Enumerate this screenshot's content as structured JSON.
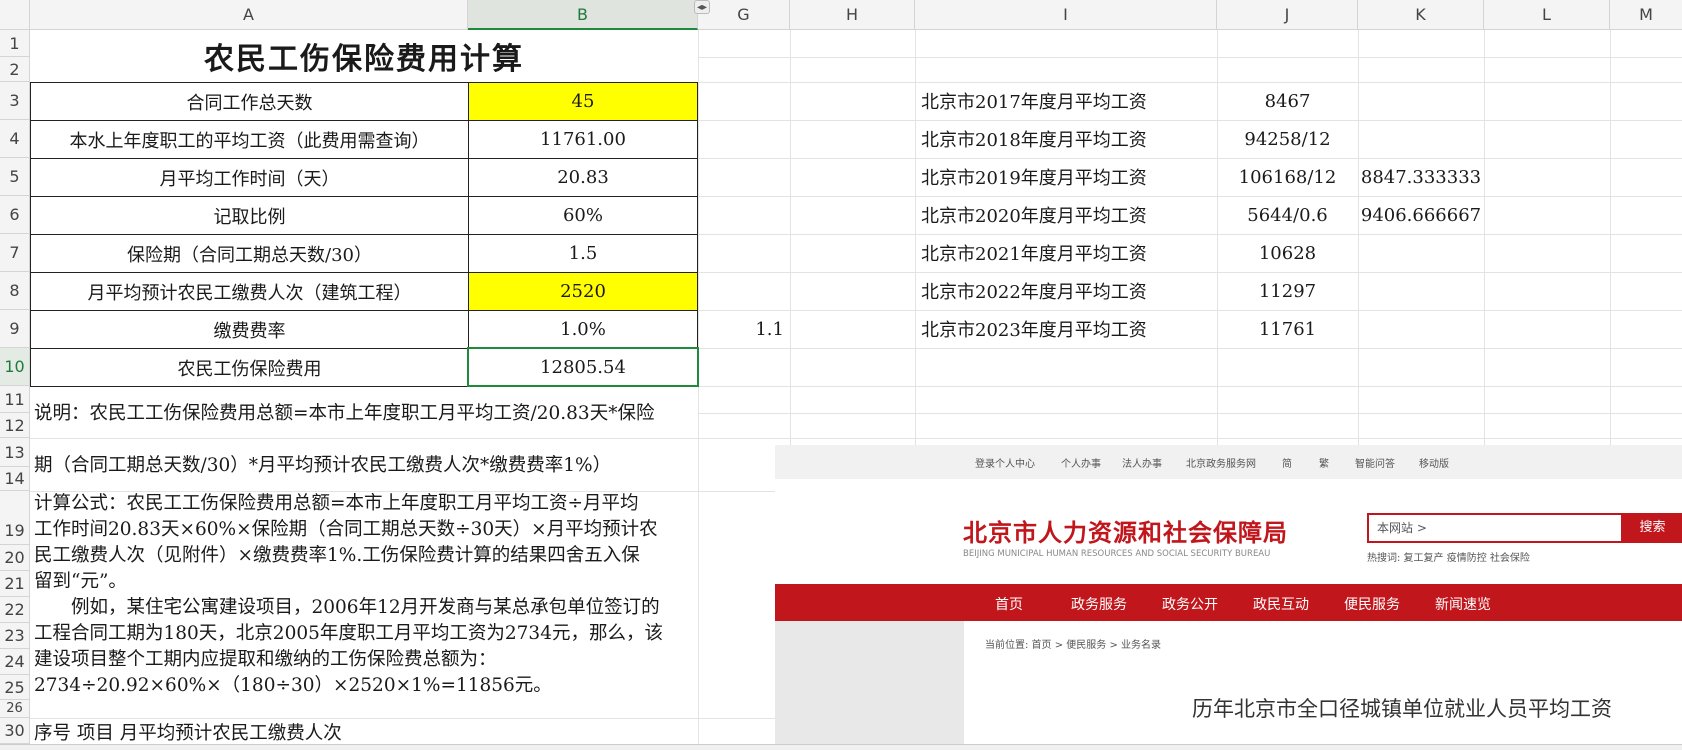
{
  "columns": [
    "A",
    "B",
    "G",
    "H",
    "I",
    "J",
    "K",
    "L",
    "M"
  ],
  "rows": [
    "1",
    "2",
    "3",
    "4",
    "5",
    "6",
    "7",
    "8",
    "9",
    "10",
    "11",
    "12",
    "13",
    "14",
    "19",
    "20",
    "21",
    "22",
    "23",
    "24",
    "25",
    "26",
    "30"
  ],
  "sheet": {
    "title": "农民工伤保险费用计算",
    "table": [
      {
        "label": "合同工作总天数",
        "value": "45",
        "highlight": "#ffff00"
      },
      {
        "label": "本水上年度职工的平均工资（此费用需查询）",
        "value": "11761.00"
      },
      {
        "label": "月平均工作时间（天）",
        "value": "20.83"
      },
      {
        "label": "记取比例",
        "value": "60%"
      },
      {
        "label": "保险期（合同工期总天数/30）",
        "value": "1.5"
      },
      {
        "label": "月平均预计农民工缴费人次（建筑工程）",
        "value": "2520",
        "highlight": "#ffff00"
      },
      {
        "label": "缴费费率",
        "value": "1.0%"
      },
      {
        "label": "农民工伤保险费用",
        "value": "12805.54"
      }
    ],
    "g9_value": "1.1",
    "wages": [
      {
        "label": "北京市2017年度月平均工资",
        "value": "8467",
        "extra": ""
      },
      {
        "label": "北京市2018年度月平均工资",
        "value": "94258/12",
        "extra": ""
      },
      {
        "label": "北京市2019年度月平均工资",
        "value": "106168/12",
        "extra": "8847.333333"
      },
      {
        "label": "北京市2020年度月平均工资",
        "value": "5644/0.6",
        "extra": "9406.666667"
      },
      {
        "label": "北京市2021年度月平均工资",
        "value": "10628",
        "extra": ""
      },
      {
        "label": "北京市2022年度月平均工资",
        "value": "11297",
        "extra": ""
      },
      {
        "label": "北京市2023年度月平均工资",
        "value": "11761",
        "extra": ""
      }
    ],
    "explanation_line1": "说明：农民工工伤保险费用总额=本市上年度职工月平均工资/20.83天*保险",
    "explanation_line2": "期（合同工期总天数/30）*月平均预计农民工缴费人次*缴费费率1%）",
    "formula_lines": [
      "计算公式：农民工工伤保险费用总额=本市上年度职工月平均工资÷月平均",
      "工作时间20.83天×60%×保险期（合同工期总天数÷30天）×月平均预计农",
      "民工缴费人次（见附件）×缴费费率1%.工伤保险费计算的结果四舍五入保",
      "留到“元”。",
      "　　例如，某住宅公寓建设项目，2006年12月开发商与某总承包单位签订的",
      "工程合同工期为180天，北京2005年度职工月平均工资为2734元，那么，该",
      "建设项目整个工期内应提取和缴纳的工伤保险费总额为：",
      "2734÷20.92×60%×（180÷30）×2520×1%=11856元。"
    ],
    "row30_text": "序号  项目  月平均预计农民工缴费人次"
  },
  "website": {
    "top_links": [
      "登录个人中心",
      "个人办事",
      "法人办事",
      "北京政务服务网",
      "简",
      "繁",
      "智能问答",
      "移动版"
    ],
    "logo_cn": "北京市人力资源和社会保障局",
    "logo_en": "BEIJING MUNICIPAL HUMAN RESOURCES AND SOCIAL SECURITY BUREAU",
    "search_placeholder": "本网站 >",
    "search_button": "搜索",
    "hot_words": "热搜词:  复工复产  疫情防控  社会保险",
    "nav": [
      "首页",
      "政务服务",
      "政务公开",
      "政民互动",
      "便民服务",
      "新闻速览"
    ],
    "breadcrumb": "当前位置:  首页 > 便民服务 > 业务名录",
    "heading": "历年北京市全口径城镇单位就业人员平均工资",
    "brand_color": "#c0161c"
  },
  "colors": {
    "highlight": "#ffff00",
    "active_cell": "#1e8a3a",
    "header_bg": "#f4f4f4"
  }
}
